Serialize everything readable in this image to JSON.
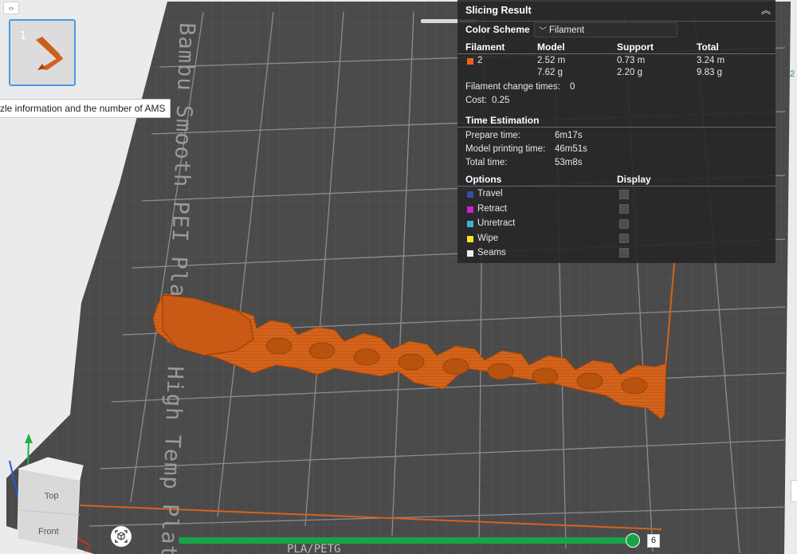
{
  "plate": {
    "label": "Bambu Smooth PEI Plate / High Temp Plate",
    "bottom_label": "PLA/PETG"
  },
  "thumbnail": {
    "index": "1"
  },
  "tooltip": "zle information and the number of AMS",
  "panel": {
    "title": "Slicing Result",
    "color_scheme_label": "Color Scheme",
    "color_scheme_value": "Filament",
    "filament_headers": [
      "Filament",
      "Model",
      "Support",
      "Total"
    ],
    "filament_row": {
      "id": "2",
      "color": "#e8661c",
      "model_length": "2.52 m",
      "model_weight": "7.62 g",
      "support_length": "0.73 m",
      "support_weight": "2.20 g",
      "total_length": "3.24 m",
      "total_weight": "9.83 g"
    },
    "filament_change_label": "Filament change times:",
    "filament_change_value": "0",
    "cost_label": "Cost:",
    "cost_value": "0.25",
    "time_header": "Time Estimation",
    "prepare_label": "Prepare time:",
    "prepare_value": "6m17s",
    "model_time_label": "Model printing time:",
    "model_time_value": "46m51s",
    "total_time_label": "Total time:",
    "total_time_value": "53m8s",
    "options_header": "Options",
    "display_header": "Display",
    "options": [
      {
        "label": "Travel",
        "color": "#3a4d9c"
      },
      {
        "label": "Retract",
        "color": "#d020c8"
      },
      {
        "label": "Unretract",
        "color": "#3eb0d8"
      },
      {
        "label": "Wipe",
        "color": "#f2e81a"
      },
      {
        "label": "Seams",
        "color": "#eeeeee"
      }
    ]
  },
  "right_tag": "2",
  "view_cube": {
    "top": "Top",
    "front": "Front",
    "x_axis": "X"
  },
  "layer_slider": {
    "value": "6",
    "fraction": 0.99
  }
}
